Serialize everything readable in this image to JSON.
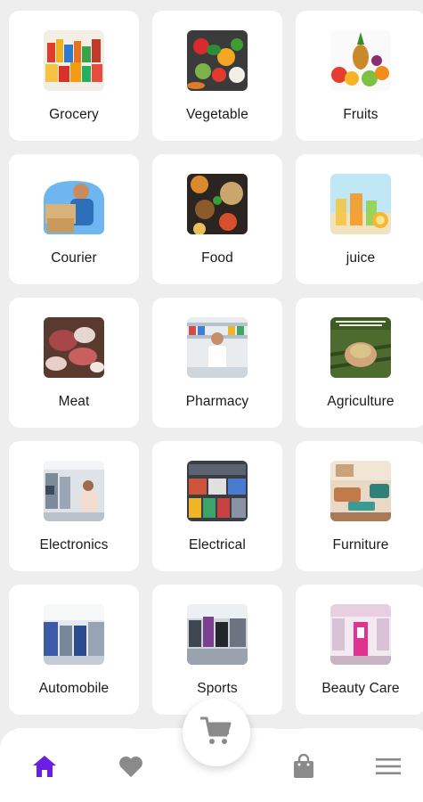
{
  "categories": [
    {
      "label": "Grocery",
      "icon": "grocery-icon"
    },
    {
      "label": "Vegetable",
      "icon": "vegetable-icon"
    },
    {
      "label": "Fruits",
      "icon": "fruits-icon"
    },
    {
      "label": "Courier",
      "icon": "courier-icon"
    },
    {
      "label": "Food",
      "icon": "food-icon"
    },
    {
      "label": "juice",
      "icon": "juice-icon"
    },
    {
      "label": "Meat",
      "icon": "meat-icon"
    },
    {
      "label": "Pharmacy",
      "icon": "pharmacy-icon"
    },
    {
      "label": "Agriculture",
      "icon": "agriculture-icon"
    },
    {
      "label": "Electronics",
      "icon": "electronics-icon"
    },
    {
      "label": "Electrical",
      "icon": "electrical-icon"
    },
    {
      "label": "Furniture",
      "icon": "furniture-icon"
    },
    {
      "label": "Automobile",
      "icon": "automobile-icon"
    },
    {
      "label": "Sports",
      "icon": "sports-icon"
    },
    {
      "label": "Beauty Care",
      "icon": "beauty-care-icon"
    }
  ],
  "nav": {
    "items": [
      {
        "icon": "home-icon",
        "active": true
      },
      {
        "icon": "heart-icon",
        "active": false
      },
      {
        "icon": "cart-icon",
        "active": false
      },
      {
        "icon": "shopping-bag-icon",
        "active": false
      },
      {
        "icon": "menu-icon",
        "active": false
      }
    ],
    "active_color": "#6a1ee6",
    "inactive_color": "#8a8a8a"
  }
}
